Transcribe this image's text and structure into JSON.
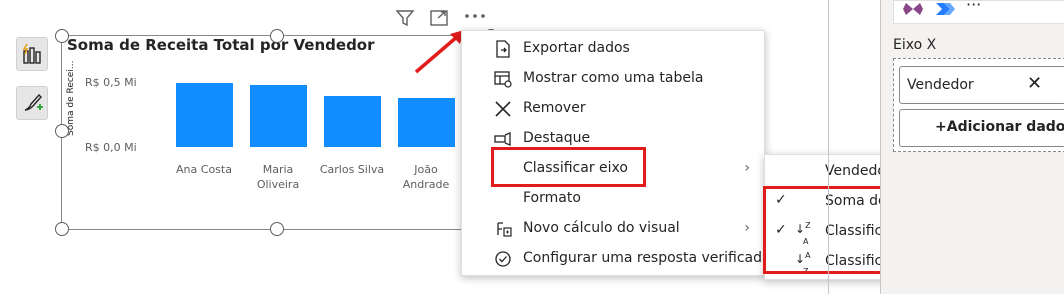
{
  "visual": {
    "title": "Soma de Receita Total por Vendedor",
    "y_axis_title": "Soma de Recei...",
    "header_icons": [
      "filter-icon",
      "focus-mode-icon",
      "more-options-icon"
    ]
  },
  "chart_data": {
    "type": "bar",
    "title": "Soma de Receita Total por Vendedor",
    "ylabel": "Soma de Recei...",
    "xlabel": "",
    "y_ticks": [
      "R$ 0,5 Mi",
      "R$ 0,0 Mi"
    ],
    "ylim": [
      0,
      0.5
    ],
    "categories": [
      "Ana Costa",
      "Maria Oliveira",
      "Carlos Silva",
      "João Andrade"
    ],
    "values": [
      0.49,
      0.48,
      0.39,
      0.38
    ],
    "bar_color": "#118dff",
    "grid": false
  },
  "context_menu": {
    "items": [
      {
        "label": "Exportar dados",
        "icon": "export-icon"
      },
      {
        "label": "Mostrar como uma tabela",
        "icon": "table-icon"
      },
      {
        "label": "Remover",
        "icon": "close-icon"
      },
      {
        "label": "Destaque",
        "icon": "spotlight-icon"
      },
      {
        "label": "Classificar eixo",
        "icon": "",
        "has_submenu": true
      },
      {
        "label": "Formato",
        "icon": ""
      },
      {
        "label": "Novo cálculo do visual",
        "icon": "calculation-icon",
        "has_submenu": true
      },
      {
        "label": "Configurar uma resposta verificada",
        "icon": "check-circle-icon"
      }
    ]
  },
  "sort_submenu": {
    "items": [
      {
        "label": "Vendedor",
        "checked": false,
        "sort_icon": ""
      },
      {
        "label": "Soma de Receita Total",
        "checked": true,
        "sort_icon": ""
      },
      {
        "label": "Classificar em ordem decrescente",
        "checked": true,
        "sort_icon": "sort-descending-icon"
      },
      {
        "label": "Classificar em ordem crescente",
        "checked": false,
        "sort_icon": "sort-ascending-icon"
      }
    ]
  },
  "right_panel": {
    "axis_label": "Eixo X",
    "field_pill": "Vendedor",
    "add_data_label": "+Adicionar dados",
    "more_label": "···"
  },
  "colors": {
    "accent": "#118dff",
    "highlight": "#e21b1b"
  }
}
